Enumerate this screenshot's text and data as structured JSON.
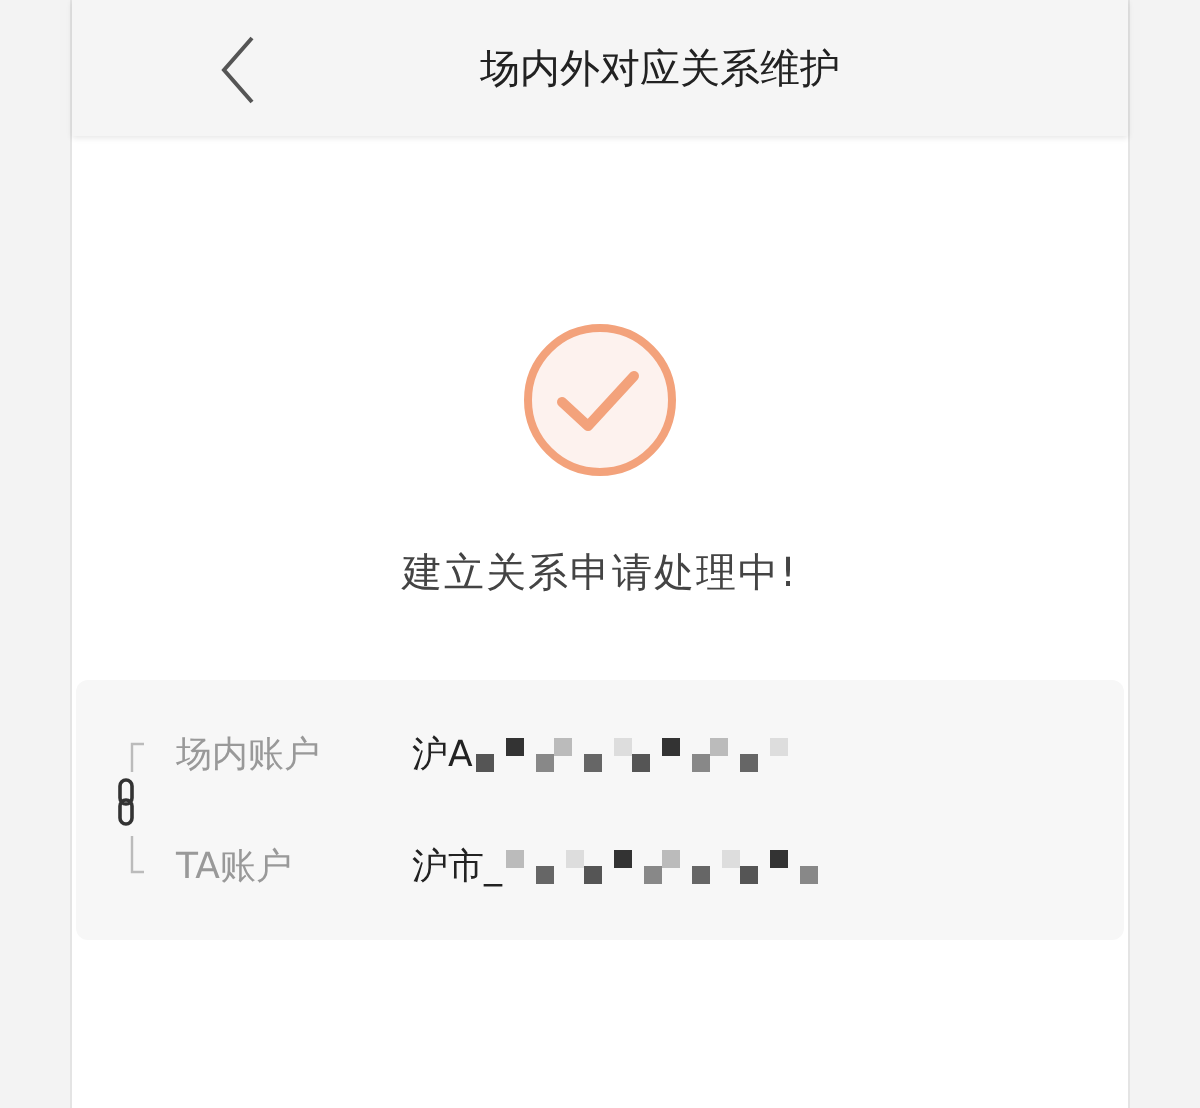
{
  "header": {
    "title": "场内外对应关系维护"
  },
  "status": {
    "message": "建立关系申请处理中!"
  },
  "accounts": [
    {
      "label": "场内账户",
      "value": "沪A"
    },
    {
      "label": "TA账户",
      "value": "沪市_"
    }
  ]
}
